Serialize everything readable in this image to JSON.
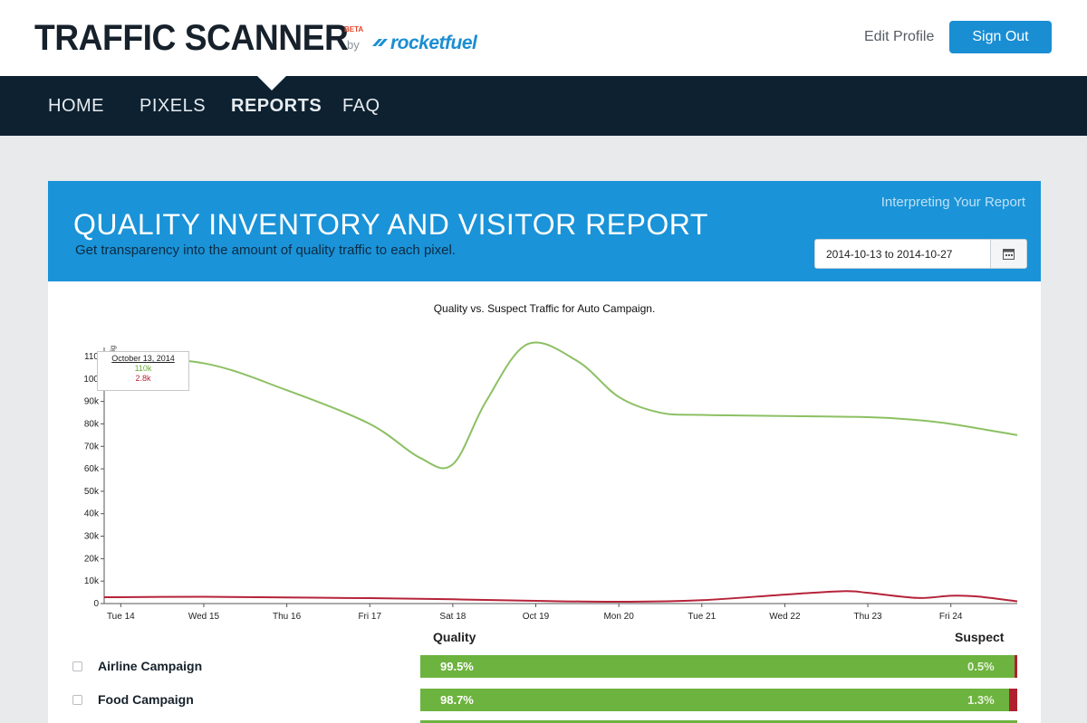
{
  "header": {
    "brand_title": "TRAFFIC SCANNER",
    "brand_beta": "BETA",
    "brand_by": "by",
    "brand_logo": "rocketfuel",
    "edit_profile": "Edit Profile",
    "sign_out": "Sign Out"
  },
  "nav": {
    "items": [
      "HOME",
      "PIXELS",
      "REPORTS",
      "FAQ"
    ],
    "active": "REPORTS"
  },
  "report": {
    "interpret_link": "Interpreting Your Report",
    "title": "QUALITY INVENTORY AND VISITOR REPORT",
    "subtitle": "Get transparency into the amount of quality traffic to each pixel.",
    "date_range": "2014-10-13 to 2014-10-27"
  },
  "tooltip": {
    "date": "October 13, 2014",
    "quality": "110k",
    "suspect": "2.8k"
  },
  "chart_data": {
    "type": "line",
    "title": "Quality vs. Suspect Traffic for Auto Campaign.",
    "x_ticks": [
      "Tue 14",
      "Wed 15",
      "Thu 16",
      "Fri 17",
      "Sat 18",
      "Oct 19",
      "Mon 20",
      "Tue 21",
      "Wed 22",
      "Thu 23",
      "Fri 24"
    ],
    "y_ticks": [
      "0",
      "10k",
      "20k",
      "30k",
      "40k",
      "50k",
      "60k",
      "70k",
      "80k",
      "90k",
      "100",
      "110"
    ],
    "ylim": [
      0,
      115000
    ],
    "ylabel": "ig",
    "x_range": [
      13.8,
      24.8
    ],
    "colors": {
      "quality": "#8cc063",
      "suspect": "#b52339"
    },
    "series": [
      {
        "name": "Quality",
        "x": [
          13.8,
          15,
          16,
          17,
          17.6,
          18,
          18.4,
          18.9,
          19.5,
          20,
          20.5,
          21,
          22,
          23,
          23.5,
          24,
          24.8
        ],
        "values": [
          110000,
          107000,
          95000,
          80000,
          65000,
          62000,
          90000,
          115500,
          108000,
          92000,
          85000,
          84000,
          83500,
          83000,
          82000,
          80000,
          75000
        ]
      },
      {
        "name": "Suspect",
        "x": [
          13.8,
          15,
          16,
          17,
          18,
          19,
          20,
          21,
          22,
          22.7,
          23,
          23.6,
          24,
          24.3,
          24.8
        ],
        "values": [
          2800,
          3000,
          2700,
          2400,
          1900,
          1200,
          800,
          1500,
          4000,
          5500,
          4800,
          2500,
          3500,
          3200,
          1000
        ]
      }
    ]
  },
  "campaigns": {
    "quality_header": "Quality",
    "suspect_header": "Suspect",
    "rows": [
      {
        "name": "Airline Campaign",
        "quality": "99.5%",
        "suspect": "0.5%",
        "suspect_fraction": 0.005
      },
      {
        "name": "Food Campaign",
        "quality": "98.7%",
        "suspect": "1.3%",
        "suspect_fraction": 0.013
      }
    ]
  }
}
